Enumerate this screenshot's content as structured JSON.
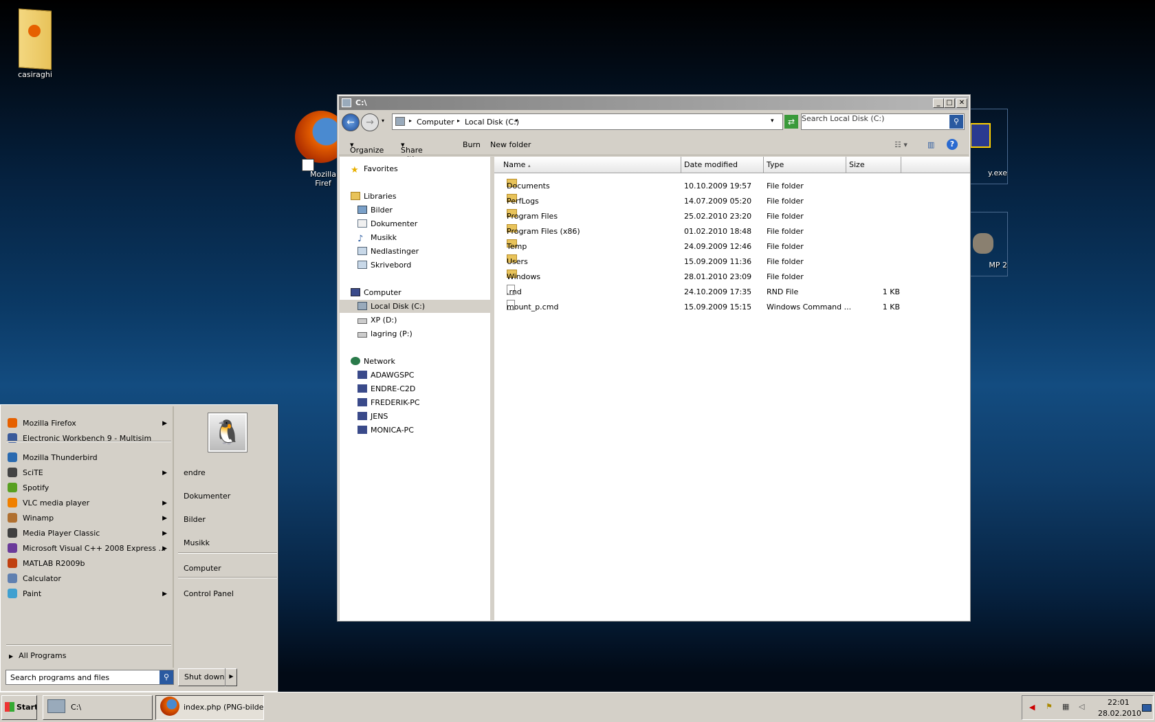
{
  "desktop": {
    "icons": [
      {
        "label": "casiraghi"
      },
      {
        "label": "Mozilla Firef"
      },
      {
        "label": "y.exe"
      },
      {
        "label": "MP 2"
      }
    ]
  },
  "explorer": {
    "title": "C:\\",
    "breadcrumb": [
      "Computer",
      "Local Disk (C:)"
    ],
    "search_placeholder": "Search Local Disk (C:)",
    "toolbar": {
      "organize": "Organize",
      "share": "Share with",
      "burn": "Burn",
      "new_folder": "New folder"
    },
    "nav": {
      "favorites": "Favorites",
      "libraries": "Libraries",
      "library_items": [
        "Bilder",
        "Dokumenter",
        "Musikk",
        "Nedlastinger",
        "Skrivebord"
      ],
      "computer": "Computer",
      "drives": [
        "Local Disk (C:)",
        "XP (D:)",
        "lagring (P:)"
      ],
      "network": "Network",
      "network_items": [
        "ADAWGSPC",
        "ENDRE-C2D",
        "FREDERIK-PC",
        "JENS",
        "MONICA-PC"
      ]
    },
    "columns": {
      "name": "Name",
      "date": "Date modified",
      "type": "Type",
      "size": "Size"
    },
    "files": [
      {
        "name": "Documents",
        "date": "10.10.2009 19:57",
        "type": "File folder",
        "size": "",
        "folder": true
      },
      {
        "name": "PerfLogs",
        "date": "14.07.2009 05:20",
        "type": "File folder",
        "size": "",
        "folder": true
      },
      {
        "name": "Program Files",
        "date": "25.02.2010 23:20",
        "type": "File folder",
        "size": "",
        "folder": true
      },
      {
        "name": "Program Files (x86)",
        "date": "01.02.2010 18:48",
        "type": "File folder",
        "size": "",
        "folder": true
      },
      {
        "name": "Temp",
        "date": "24.09.2009 12:46",
        "type": "File folder",
        "size": "",
        "folder": true
      },
      {
        "name": "Users",
        "date": "15.09.2009 11:36",
        "type": "File folder",
        "size": "",
        "folder": true
      },
      {
        "name": "Windows",
        "date": "28.01.2010 23:09",
        "type": "File folder",
        "size": "",
        "folder": true
      },
      {
        "name": ".rnd",
        "date": "24.10.2009 17:35",
        "type": "RND File",
        "size": "1 KB",
        "folder": false
      },
      {
        "name": "mount_p.cmd",
        "date": "15.09.2009 15:15",
        "type": "Windows Command ...",
        "size": "1 KB",
        "folder": false
      }
    ]
  },
  "startmenu": {
    "programs": [
      {
        "label": "Mozilla Firefox",
        "arrow": true,
        "color": "#e66000"
      },
      {
        "label": "Electronic Workbench 9 - Multisim",
        "arrow": false,
        "color": "#3a5a9a"
      },
      {
        "label": "Mozilla Thunderbird",
        "arrow": false,
        "color": "#2a6ab0"
      },
      {
        "label": "SciTE",
        "arrow": true,
        "color": "#444444"
      },
      {
        "label": "Spotify",
        "arrow": false,
        "color": "#58a020"
      },
      {
        "label": "VLC media player",
        "arrow": true,
        "color": "#f08000"
      },
      {
        "label": "Winamp",
        "arrow": true,
        "color": "#b07030"
      },
      {
        "label": "Media Player Classic",
        "arrow": true,
        "color": "#404040"
      },
      {
        "label": "Microsoft Visual C++ 2008 Express ...",
        "arrow": true,
        "color": "#6a3a9a"
      },
      {
        "label": "MATLAB R2009b",
        "arrow": false,
        "color": "#c04010"
      },
      {
        "label": "Calculator",
        "arrow": false,
        "color": "#6080b0"
      },
      {
        "label": "Paint",
        "arrow": true,
        "color": "#40a0d0"
      }
    ],
    "all_programs": "All Programs",
    "search_placeholder": "Search programs and files",
    "places": [
      "endre",
      "Dokumenter",
      "Bilder",
      "Musikk",
      "Computer",
      "Control Panel"
    ],
    "shutdown": "Shut down"
  },
  "taskbar": {
    "start": "Start",
    "tasks": [
      "C:\\",
      "index.php (PNG-bilde..."
    ],
    "time": "22:01",
    "date": "28.02.2010"
  }
}
